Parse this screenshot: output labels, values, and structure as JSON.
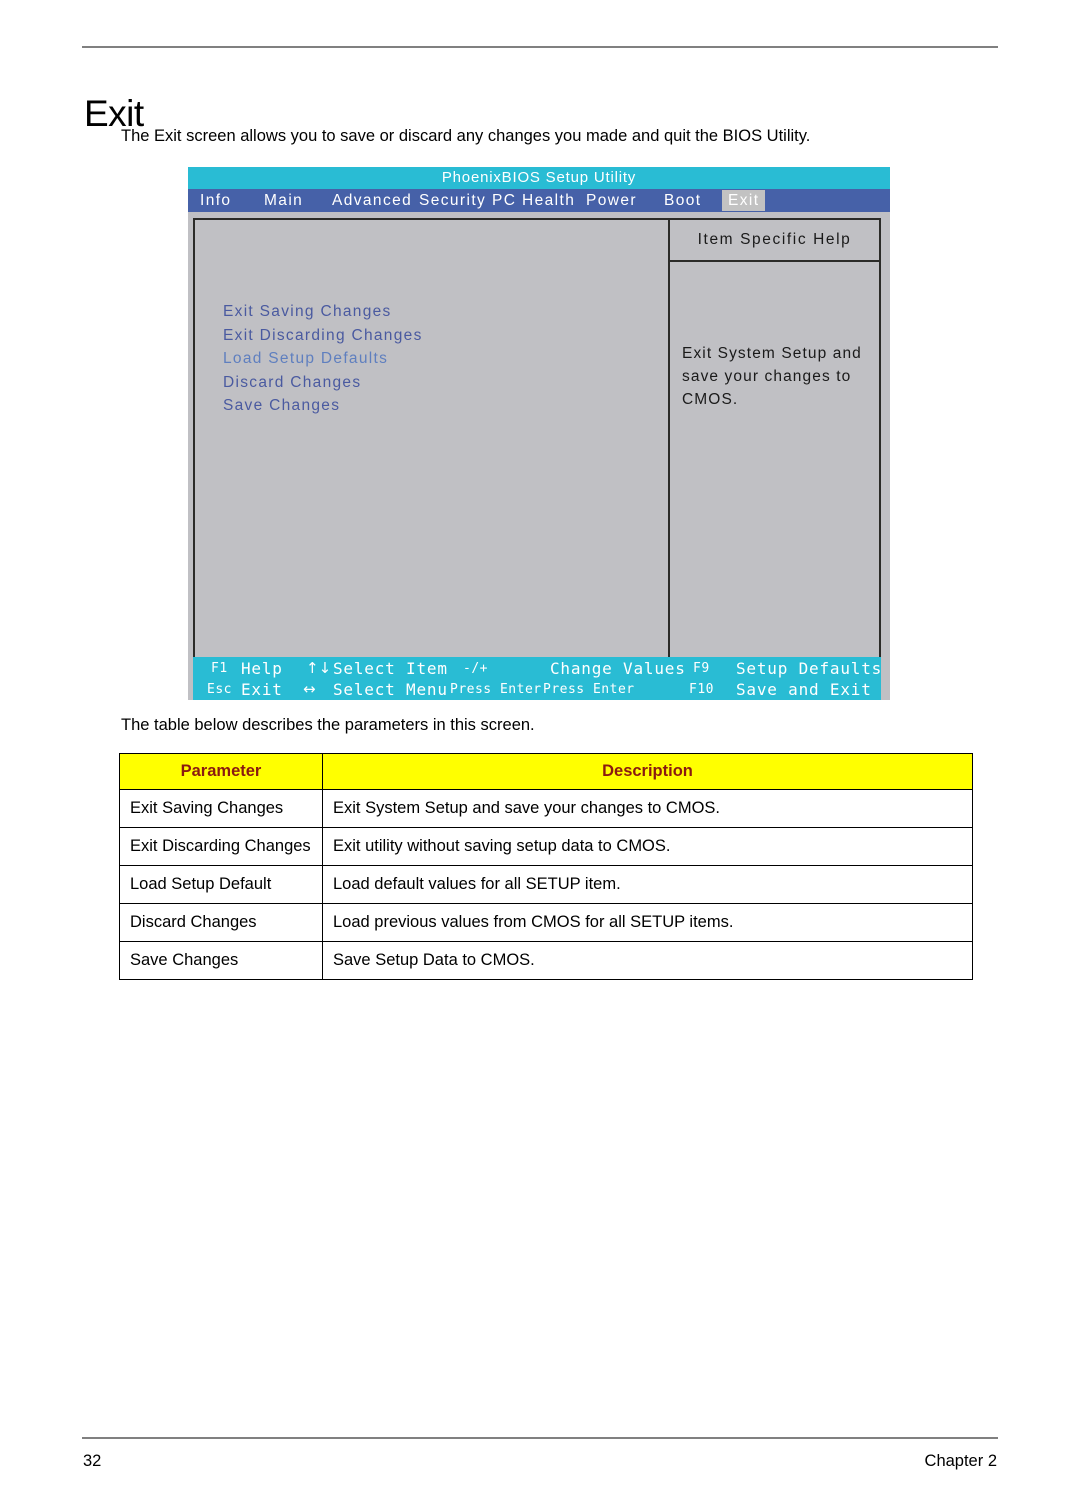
{
  "document": {
    "title": "Exit",
    "intro": "The Exit screen allows you to save or discard any changes you made and quit the BIOS Utility.",
    "table_intro": "The table below describes the parameters in this screen.",
    "footer_page": "32",
    "footer_chapter": "Chapter 2"
  },
  "bios": {
    "title": "PhoenixBIOS Setup Utility",
    "tabs": [
      {
        "label": "Info",
        "active": false
      },
      {
        "label": "Main",
        "active": false
      },
      {
        "label": "Advanced",
        "active": false
      },
      {
        "label": "Security",
        "active": false
      },
      {
        "label": "PC Health",
        "active": false
      },
      {
        "label": "Power",
        "active": false
      },
      {
        "label": "Boot",
        "active": false
      },
      {
        "label": "Exit",
        "active": true
      }
    ],
    "menu_items": [
      "Exit Saving Changes",
      "Exit Discarding Changes",
      "Load Setup Defaults",
      "Discard Changes",
      "Save Changes"
    ],
    "help": {
      "title": "Item Specific Help",
      "lines": [
        "Exit System Setup and",
        "save your changes to",
        "CMOS."
      ]
    },
    "keybar": {
      "row1": [
        {
          "key": "F1",
          "action": "Help"
        },
        {
          "key": "↑↓",
          "action": "Select Item"
        },
        {
          "key": "-/+",
          "action": "Change Values"
        },
        {
          "key": "F9",
          "action": "Setup Defaults"
        }
      ],
      "row2": [
        {
          "key": "Esc",
          "action": "Exit"
        },
        {
          "key": "↔",
          "action": "Select Menu"
        },
        {
          "key": "Press Enter",
          "action": "Press Enter"
        },
        {
          "key": "F10",
          "action": "Save and Exit"
        }
      ]
    },
    "colors": {
      "title_bar": "#29bcd4",
      "tab_bar": "#4661a8",
      "body": "#c0c0c4",
      "menu_text": "#4a5aa0",
      "key_bar": "#29bcd4",
      "active_tab": "#c2c2c2"
    }
  },
  "table": {
    "headers": [
      "Parameter",
      "Description"
    ],
    "header_bg": "#ffff00",
    "header_color": "#8a1a10",
    "rows": [
      {
        "parameter": "Exit Saving Changes",
        "description": "Exit System Setup and save your changes to CMOS."
      },
      {
        "parameter": "Exit Discarding Changes",
        "description": "Exit utility without saving setup data to CMOS."
      },
      {
        "parameter": "Load Setup Default",
        "description": "Load default values for all SETUP item."
      },
      {
        "parameter": "Discard Changes",
        "description": "Load previous values from CMOS for all SETUP items."
      },
      {
        "parameter": "Save Changes",
        "description": "Save Setup Data to CMOS."
      }
    ]
  }
}
